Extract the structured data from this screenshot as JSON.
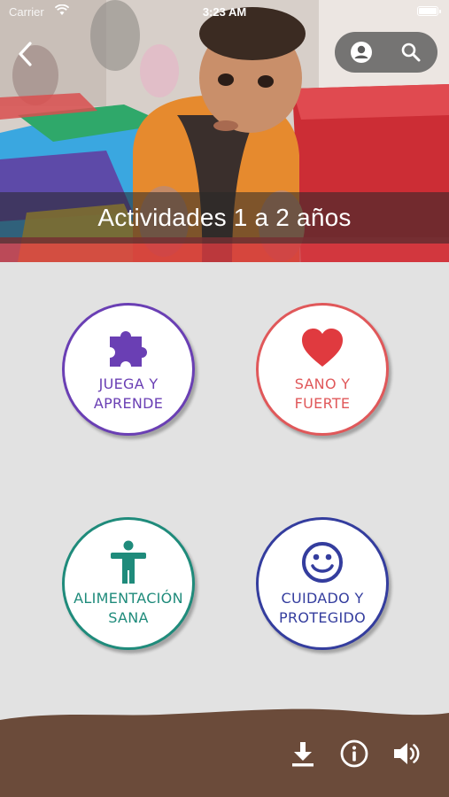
{
  "status_bar": {
    "carrier": "Carrier",
    "time": "3:23 AM"
  },
  "header": {
    "title": "Actividades 1 a 2 años"
  },
  "categories": [
    {
      "line1": "JUEGA Y",
      "line2": "APRENDE",
      "color": "#6a3fb4",
      "icon": "puzzle-piece-icon"
    },
    {
      "line1": "SANO Y",
      "line2": "FUERTE",
      "color": "#e0585a",
      "icon": "heart-icon"
    },
    {
      "line1": "ALIMENTACIÓN",
      "line2": "SANA",
      "color": "#1f8b7b",
      "icon": "person-icon"
    },
    {
      "line1": "CUIDADO Y",
      "line2": "PROTEGIDO",
      "color": "#343d9e",
      "icon": "smiley-icon"
    }
  ],
  "bottom_bar": {
    "color": "#6b4b3a",
    "icons": [
      "download-icon",
      "info-icon",
      "speaker-icon"
    ]
  }
}
